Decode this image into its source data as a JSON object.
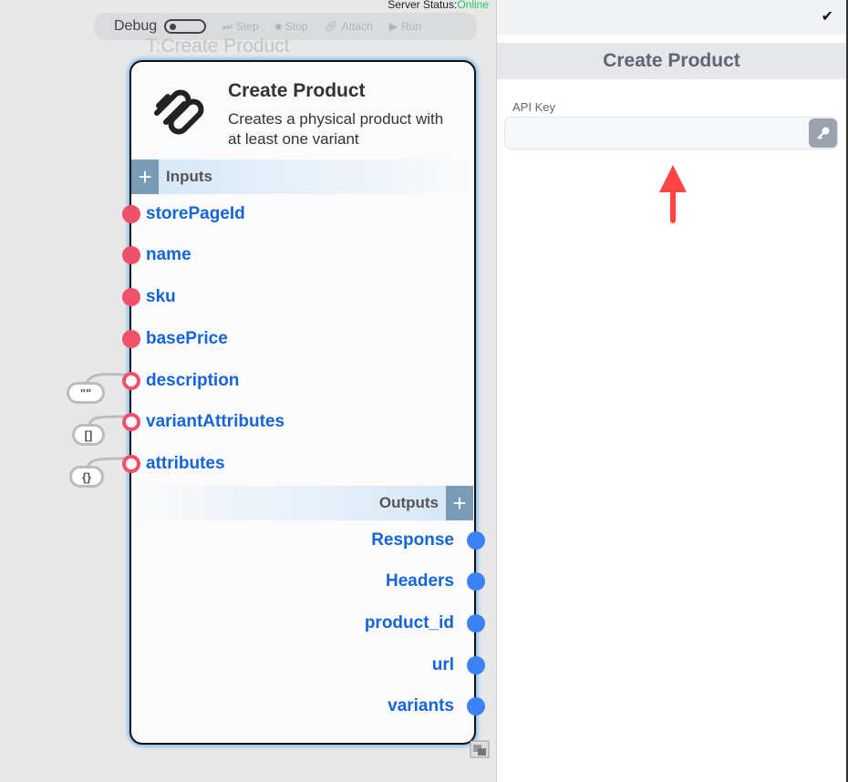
{
  "status": {
    "label": "Server Status:",
    "value": "Online"
  },
  "toolbar": {
    "debug": "Debug",
    "step": "Step",
    "stop": "Stop",
    "attach": "Attach",
    "run": "Run"
  },
  "node": {
    "type_title": "T:Create Product",
    "title": "Create Product",
    "description": "Creates a physical product with at least one variant",
    "inputs_label": "Inputs",
    "outputs_label": "Outputs",
    "inputs": [
      {
        "name": "storePageId",
        "required": true
      },
      {
        "name": "name",
        "required": true
      },
      {
        "name": "sku",
        "required": true
      },
      {
        "name": "basePrice",
        "required": true
      },
      {
        "name": "description",
        "required": false,
        "default": "\"\""
      },
      {
        "name": "variantAttributes",
        "required": false,
        "default": "[]"
      },
      {
        "name": "attributes",
        "required": false,
        "default": "{}"
      }
    ],
    "outputs": [
      "Response",
      "Headers",
      "product_id",
      "url",
      "variants"
    ]
  },
  "panel": {
    "title": "Create Product",
    "api_key_label": "API Key",
    "api_key_value": ""
  },
  "colors": {
    "required": "#f0506a",
    "output": "#3b82f6",
    "accent": "#1565d8",
    "online": "#22c55e"
  }
}
